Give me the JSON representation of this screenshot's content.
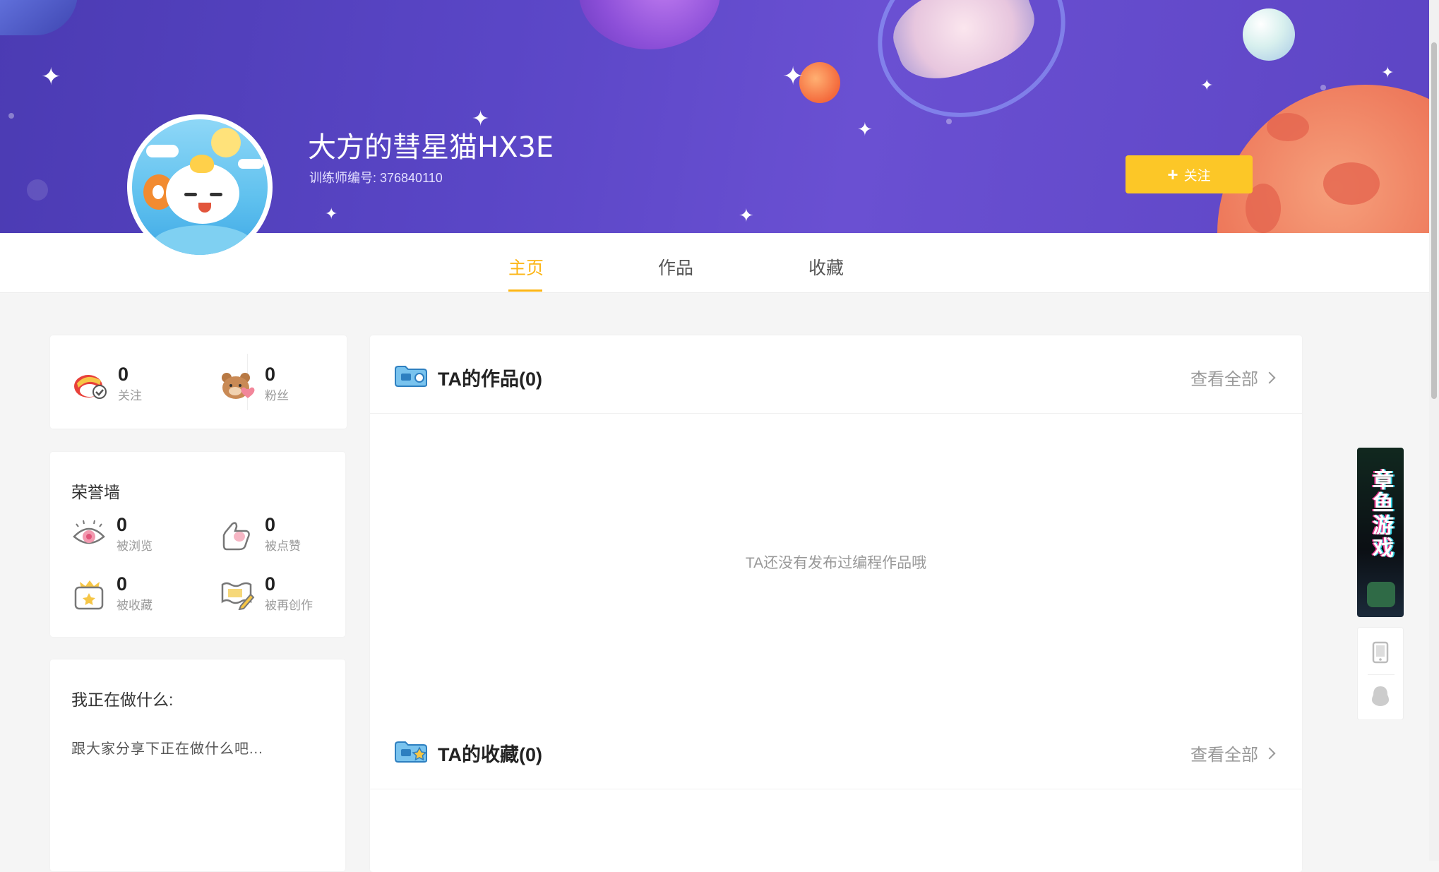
{
  "profile": {
    "username": "大方的彗星猫HX3E",
    "trainer_id": "训练师编号: 376840110",
    "follow_label": "关注"
  },
  "tabs": [
    {
      "label": "主页",
      "active": true
    },
    {
      "label": "作品",
      "active": false
    },
    {
      "label": "收藏",
      "active": false
    }
  ],
  "social_stats": [
    {
      "value": "0",
      "label": "关注",
      "icon": "follow-bird-icon"
    },
    {
      "value": "0",
      "label": "粉丝",
      "icon": "fans-bear-icon"
    }
  ],
  "honor_wall": {
    "title": "荣誉墙",
    "items": [
      {
        "value": "0",
        "label": "被浏览",
        "icon": "eye-icon"
      },
      {
        "value": "0",
        "label": "被点赞",
        "icon": "thumbs-up-icon"
      },
      {
        "value": "0",
        "label": "被收藏",
        "icon": "favorite-box-icon"
      },
      {
        "value": "0",
        "label": "被再创作",
        "icon": "recreate-pencil-icon"
      }
    ]
  },
  "status_card": {
    "title": "我正在做什么:",
    "placeholder": "跟大家分享下正在做什么吧..."
  },
  "works_section": {
    "title": "TA的作品(0)",
    "view_all": "查看全部",
    "empty_message": "TA还没有发布过编程作品哦"
  },
  "favorites_section": {
    "title": "TA的收藏(0)",
    "view_all": "查看全部"
  },
  "side_ad": {
    "text": "章鱼游戏"
  },
  "colors": {
    "accent": "#fcb515",
    "follow_button": "#fcc727",
    "banner": "#5a46c6"
  }
}
